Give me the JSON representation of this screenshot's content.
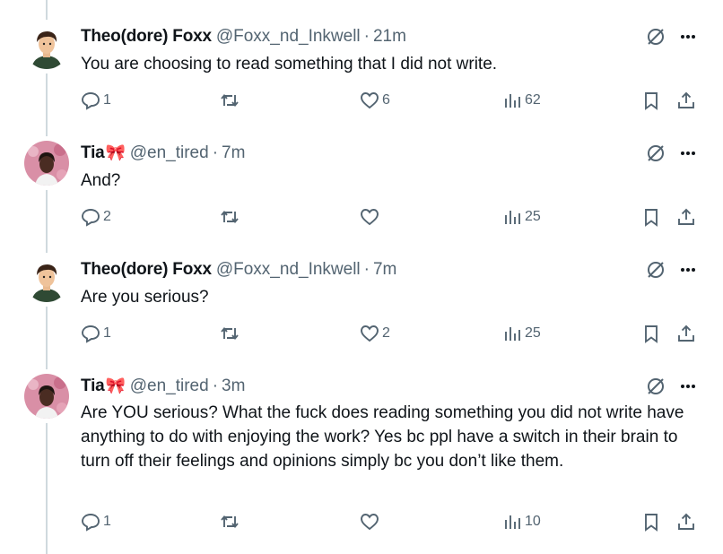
{
  "tweets": [
    {
      "name": "Theo(dore) Foxx",
      "handle": "@Foxx_nd_Inkwell",
      "separator": "·",
      "time": "21m",
      "text": "You are choosing to read something that I did not write.",
      "replies": "1",
      "retweets": "",
      "likes": "6",
      "views": "62",
      "avatar_icon": "cartoon-avatar-green-shirt"
    },
    {
      "name": "Tia",
      "name_emoji": "🎀",
      "handle": "@en_tired",
      "separator": "·",
      "time": "7m",
      "text": "And?",
      "replies": "2",
      "retweets": "",
      "likes": "",
      "views": "25",
      "avatar_icon": "photo-avatar-pink-background"
    },
    {
      "name": "Theo(dore) Foxx",
      "handle": "@Foxx_nd_Inkwell",
      "separator": "·",
      "time": "7m",
      "text": "Are you serious?",
      "replies": "1",
      "retweets": "",
      "likes": "2",
      "views": "25",
      "avatar_icon": "cartoon-avatar-green-shirt"
    },
    {
      "name": "Tia",
      "name_emoji": "🎀",
      "handle": "@en_tired",
      "separator": "·",
      "time": "3m",
      "text": "Are YOU serious? What the fuck does reading something you did not write have anything to do with enjoying the work? Yes bc ppl have a switch in their brain to turn off their feelings and opinions simply bc you don’t like them.",
      "replies": "1",
      "retweets": "",
      "likes": "",
      "views": "10",
      "avatar_icon": "photo-avatar-pink-background"
    }
  ],
  "colors": {
    "text": "#0f1419",
    "secondary": "#536471",
    "thread_line": "#cfd9de",
    "bow": "#d8232a"
  }
}
